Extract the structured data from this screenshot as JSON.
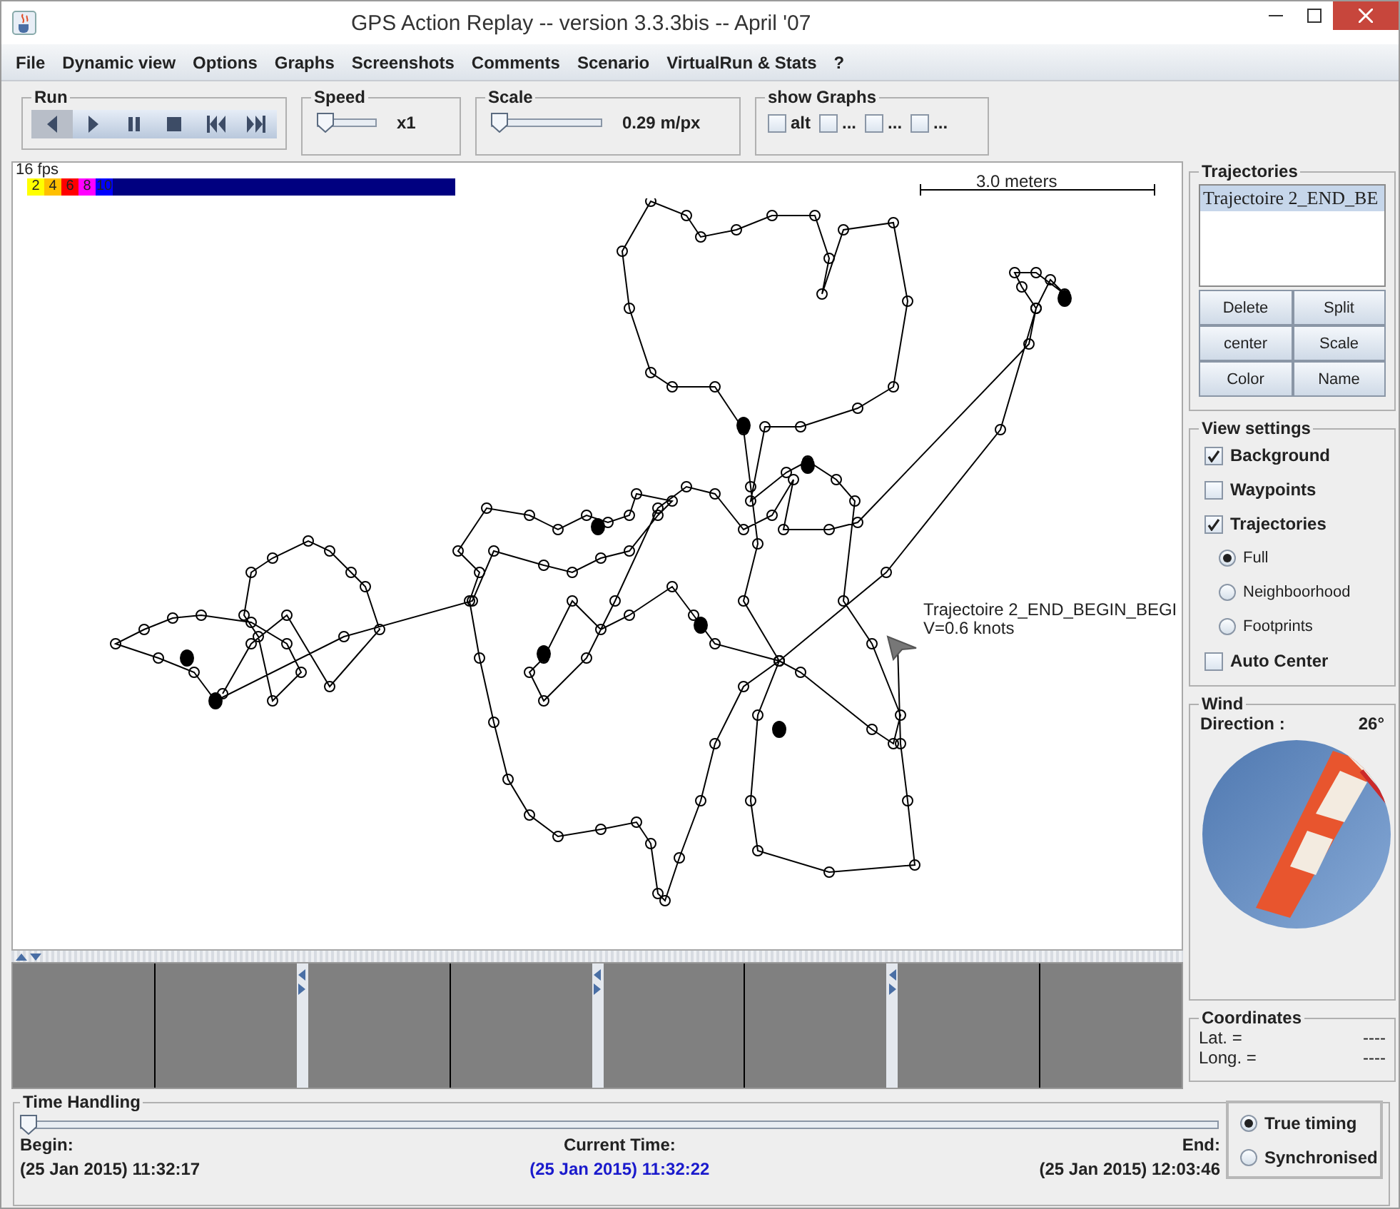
{
  "window": {
    "title": "GPS Action Replay -- version 3.3.3bis -- April '07"
  },
  "menu": [
    "File",
    "Dynamic view",
    "Options",
    "Graphs",
    "Screenshots",
    "Comments",
    "Scenario",
    "VirtualRun & Stats",
    "?"
  ],
  "run": {
    "title": "Run",
    "buttons": [
      {
        "kind": "step-back",
        "pressed": true
      },
      {
        "kind": "play",
        "pressed": false
      },
      {
        "kind": "pause",
        "pressed": false
      },
      {
        "kind": "stop",
        "pressed": false
      },
      {
        "kind": "rewind",
        "pressed": false
      },
      {
        "kind": "forward",
        "pressed": false
      }
    ]
  },
  "speed": {
    "title": "Speed",
    "level": 0,
    "reading": "x1"
  },
  "scale": {
    "title": "Scale",
    "level": 0,
    "reading": "0.29 m/px"
  },
  "show_graphs": {
    "title": "show Graphs",
    "items": [
      {
        "label": "alt",
        "checked": false
      },
      {
        "label": "...",
        "checked": false
      },
      {
        "label": "...",
        "checked": false
      },
      {
        "label": "...",
        "checked": false
      }
    ]
  },
  "map": {
    "fps": "16 fps",
    "speed_legend": [
      {
        "label": "2",
        "color": "#ffff00"
      },
      {
        "label": "4",
        "color": "#ffc000"
      },
      {
        "label": "6",
        "color": "#ff0000"
      },
      {
        "label": "8",
        "color": "#ff00ff"
      },
      {
        "label": "10",
        "color": "#0000ff"
      }
    ],
    "scale_label": "3.0 meters",
    "track_label": "Trajectoire 2_END_BEGIN_BEGI",
    "speed_label": "V=0.6 knots"
  },
  "trajectories": {
    "title": "Trajectories",
    "items": [
      {
        "label": "Trajectoire 2_END_BE",
        "selected": true
      }
    ],
    "buttons": [
      "Delete",
      "Split",
      "center",
      "Scale",
      "Color",
      "Name"
    ]
  },
  "view_settings": {
    "title": "View settings",
    "options": [
      {
        "kind": "checkbox",
        "label": "Background",
        "checked": true
      },
      {
        "kind": "checkbox",
        "label": "Waypoints",
        "checked": false
      },
      {
        "kind": "checkbox",
        "label": "Trajectories",
        "checked": true
      },
      {
        "kind": "radio",
        "label": "Full",
        "selected": true
      },
      {
        "kind": "radio",
        "label": "Neighboorhood",
        "selected": false
      },
      {
        "kind": "radio",
        "label": "Footprints",
        "selected": false
      },
      {
        "kind": "checkbox",
        "label": "Auto Center",
        "checked": false
      }
    ]
  },
  "wind": {
    "title": "Wind",
    "label": "Direction :",
    "value": "26°"
  },
  "coordinates": {
    "title": "Coordinates",
    "rows": [
      {
        "label": "Lat. =",
        "value": "----"
      },
      {
        "label": "Long. =",
        "value": "----"
      }
    ]
  },
  "time_handling": {
    "title": "Time Handling",
    "level": 0,
    "begin": {
      "label": "Begin:",
      "value": "(25 Jan 2015) 11:32:17"
    },
    "current": {
      "label": "Current Time:",
      "value": "(25 Jan 2015) 11:32:22"
    },
    "end": {
      "label": "End:",
      "value": "(25 Jan 2015) 12:03:46"
    },
    "timing": [
      {
        "label": "True timing",
        "selected": true
      },
      {
        "label": "Synchronised",
        "selected": false
      }
    ]
  }
}
